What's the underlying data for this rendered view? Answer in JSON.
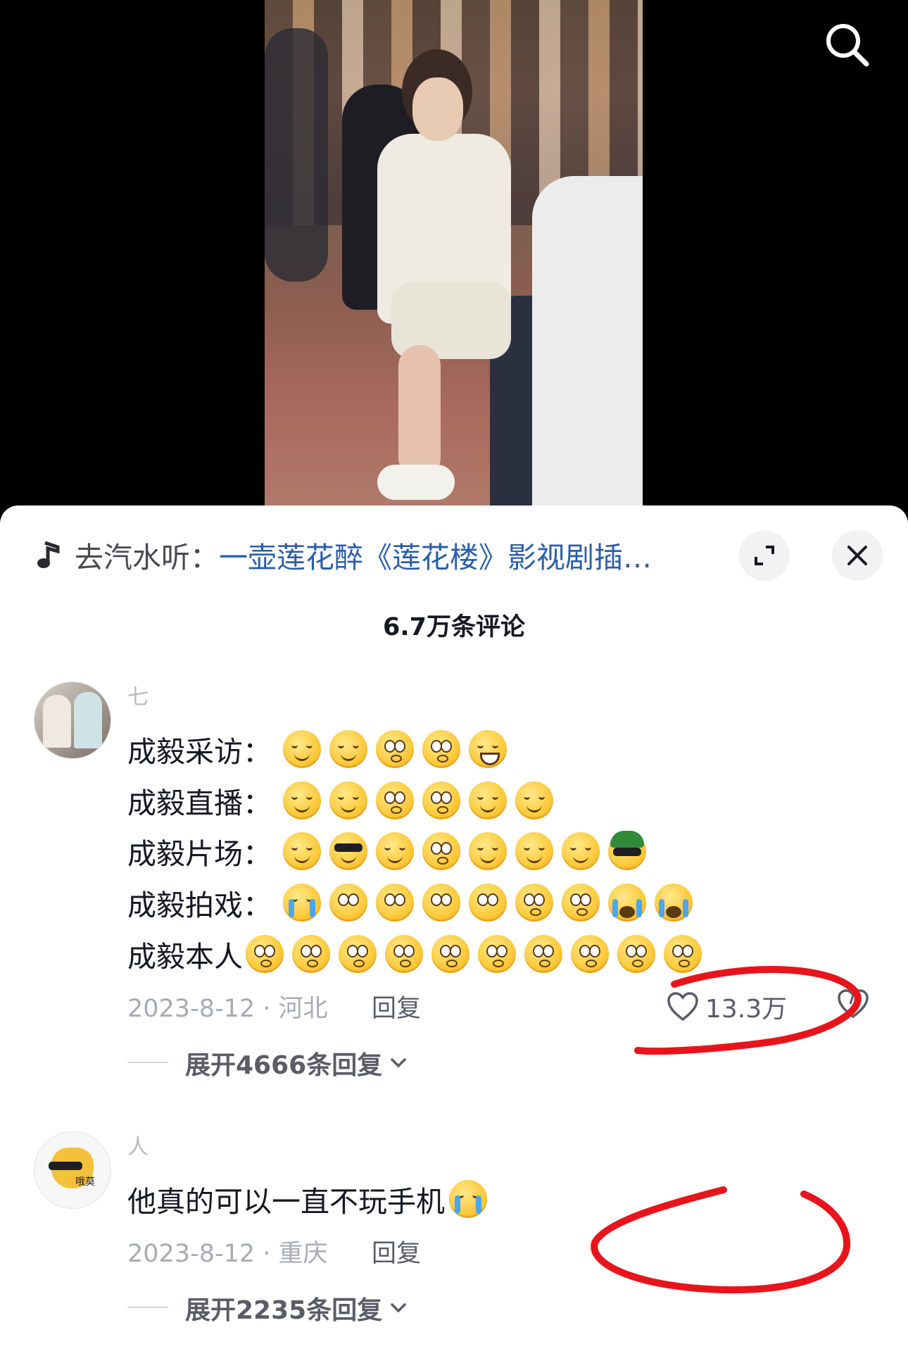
{
  "header": {
    "search_icon": "search-icon"
  },
  "music": {
    "prefix": "去汽水听：",
    "title": "一壶莲花醉《莲花楼》影视剧插…",
    "icon": "music-note-icon"
  },
  "comments_header": {
    "count_label": "6.7万条评论"
  },
  "comments": [
    {
      "username": "七",
      "lines": [
        {
          "label": "成毅采访："
        },
        {
          "label": "成毅直播："
        },
        {
          "label": "成毅片场："
        },
        {
          "label": "成毅拍戏："
        },
        {
          "label": "成毅本人"
        }
      ],
      "meta": "2023-8-12 · 河北",
      "reply_label": "回复",
      "like_count": "13.3万",
      "expand_label": "展开4666条回复"
    },
    {
      "username": "人",
      "avatar_text": "哦莫",
      "text": "他真的可以一直不玩手机",
      "meta": "2023-8-12 · 重庆",
      "reply_label": "回复",
      "expand_label": "展开2235条回复"
    }
  ],
  "annotation_color": "#e8141c"
}
